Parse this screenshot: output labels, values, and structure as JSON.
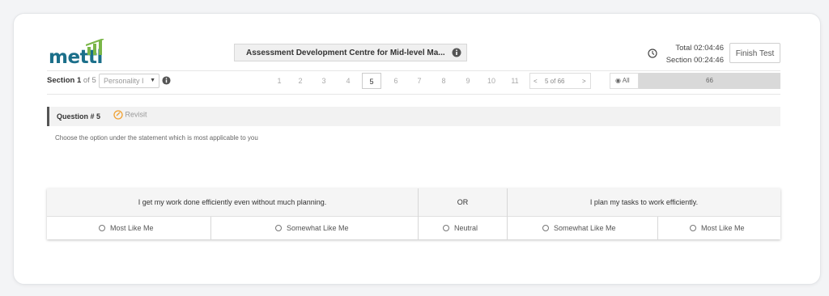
{
  "brand": {
    "logo_text": "mettl",
    "accent": "#1b6f8a",
    "bars_color": "#7ab648"
  },
  "header": {
    "test_title": "Assessment Development Centre for Mid-level Ma...",
    "total_time": "Total 02:04:46",
    "section_time": "Section 00:24:46",
    "finish_label": "Finish Test"
  },
  "section_bar": {
    "section_label": "Section",
    "section_current": "1",
    "section_of": "of 5",
    "section_select_value": "Personality I",
    "question_numbers": [
      "1",
      "2",
      "3",
      "4",
      "5",
      "6",
      "7",
      "8",
      "9",
      "10",
      "11"
    ],
    "active_question": "5",
    "pager_prev": "<",
    "pager_text": "5 of 66",
    "pager_next": ">",
    "filter_all": "All",
    "filter_count": "66"
  },
  "question": {
    "label": "Question # 5",
    "revisit_label": "Revisit",
    "instruction": "Choose the option under the statement which is most applicable to you"
  },
  "choice_grid": {
    "left_statement": "I get my work done efficiently even without much planning.",
    "middle_label": "OR",
    "right_statement": "I plan my tasks to work efficiently.",
    "options": [
      "Most Like Me",
      "Somewhat Like Me",
      "Neutral",
      "Somewhat Like Me",
      "Most Like Me"
    ]
  }
}
